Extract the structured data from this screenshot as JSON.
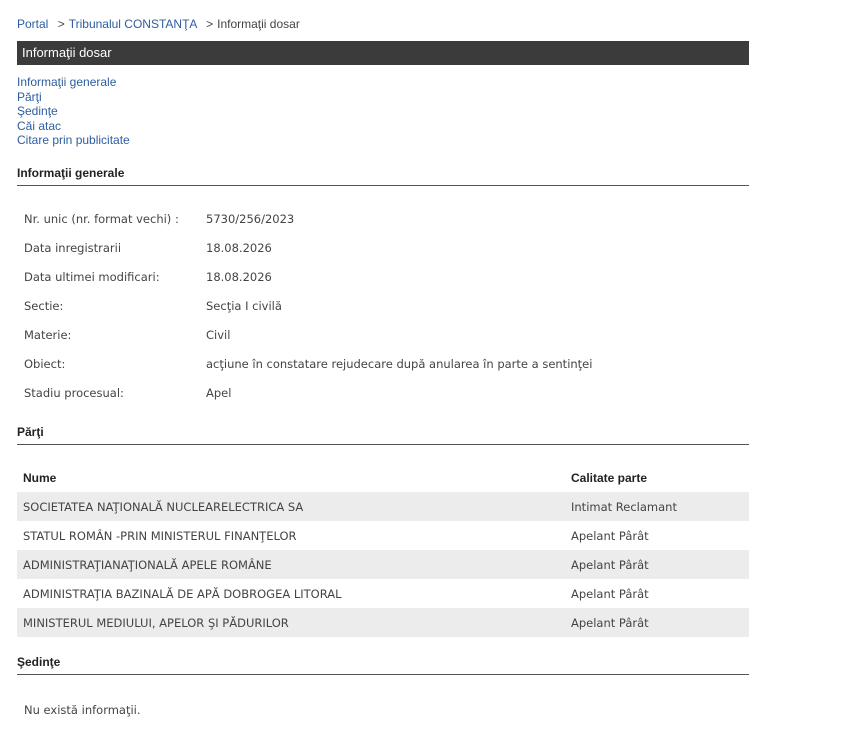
{
  "breadcrumb": {
    "portal": "Portal",
    "sep": ">",
    "court": "Tribunalul CONSTANŢA",
    "current": "Informaţii dosar"
  },
  "title": "Informaţii dosar",
  "toc": [
    "Informaţii generale",
    "Părţi",
    "Şedinţe",
    "Căi atac",
    "Citare prin publicitate"
  ],
  "general": {
    "heading": "Informaţii generale",
    "rows": [
      {
        "label": "Nr. unic (nr. format vechi) :",
        "value": "5730/256/2023"
      },
      {
        "label": "Data inregistrarii",
        "value": "18.08.2026"
      },
      {
        "label": "Data ultimei modificari:",
        "value": "18.08.2026"
      },
      {
        "label": "Sectie:",
        "value": "Secţia I civilă"
      },
      {
        "label": "Materie:",
        "value": "Civil"
      },
      {
        "label": "Obiect:",
        "value": "acţiune în constatare rejudecare după anularea în parte a sentinţei"
      },
      {
        "label": "Stadiu procesual:",
        "value": "Apel"
      }
    ]
  },
  "parti": {
    "heading": "Părţi",
    "col_name": "Nume",
    "col_role": "Calitate parte",
    "rows": [
      {
        "name": "SOCIETATEA NAŢIONALĂ NUCLEARELECTRICA SA",
        "role": "Intimat Reclamant"
      },
      {
        "name": "STATUL ROMÂN -PRIN MINISTERUL FINANŢELOR",
        "role": "Apelant Pârât"
      },
      {
        "name": "ADMINISTRAŢIANAŢIONALĂ APELE ROMÂNE",
        "role": "Apelant Pârât"
      },
      {
        "name": "ADMINISTRAŢIA BAZINALĂ DE APĂ DOBROGEA LITORAL",
        "role": "Apelant Pârât"
      },
      {
        "name": "MINISTERUL MEDIULUI, APELOR ŞI PĂDURILOR",
        "role": "Apelant Pârât"
      }
    ]
  },
  "sedinte": {
    "heading": "Şedinţe",
    "empty": "Nu există informaţii."
  }
}
